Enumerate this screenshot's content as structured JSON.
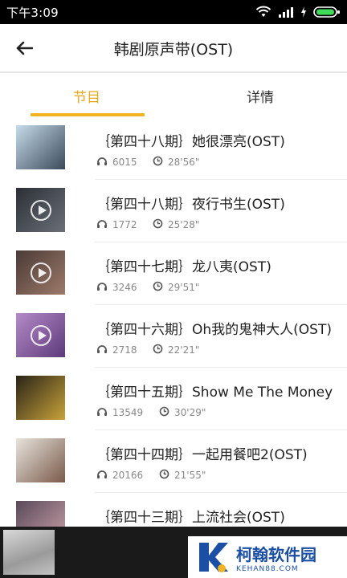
{
  "status_bar": {
    "time": "下午3:09"
  },
  "header": {
    "title": "韩剧原声带(OST)"
  },
  "tabs": [
    {
      "label": "节目",
      "active": true
    },
    {
      "label": "详情",
      "active": false
    }
  ],
  "episodes": [
    {
      "title": "｛第四十八期｝她很漂亮(OST)",
      "plays": "6015",
      "duration": "28'56\"",
      "thumb_colors": [
        "#c7dbe8",
        "#3a4a5c"
      ]
    },
    {
      "title": "｛第四十八期｝夜行书生(OST)",
      "plays": "1772",
      "duration": "25'28\"",
      "thumb_colors": [
        "#2b2f35",
        "#6b6f78"
      ]
    },
    {
      "title": "｛第四十七期｝龙八夷(OST)",
      "plays": "3246",
      "duration": "29'51\"",
      "thumb_colors": [
        "#4a3a36",
        "#9d7a6a"
      ]
    },
    {
      "title": "｛第四十六期｝Oh我的鬼神大人(OST)",
      "plays": "2718",
      "duration": "22'21\"",
      "thumb_colors": [
        "#b58ac8",
        "#5d3a7a"
      ]
    },
    {
      "title": "｛第四十五期｝Show Me The Money",
      "plays": "13549",
      "duration": "30'29\"",
      "thumb_colors": [
        "#2a2418",
        "#c8a23a"
      ]
    },
    {
      "title": "｛第四十四期｝一起用餐吧2(OST)",
      "plays": "20166",
      "duration": "21'55\"",
      "thumb_colors": [
        "#e8e4de",
        "#7a5a4a"
      ]
    },
    {
      "title": "｛第四十三期｝上流社会(OST)",
      "plays": "",
      "duration": "",
      "thumb_colors": [
        "#5a4a5a",
        "#c9a0a8"
      ]
    }
  ],
  "watermark": {
    "main": "柯翰软件园",
    "sub": "KEHAN88.COM"
  },
  "colors": {
    "accent": "#f0b323",
    "accent_text": "#e6a817"
  }
}
